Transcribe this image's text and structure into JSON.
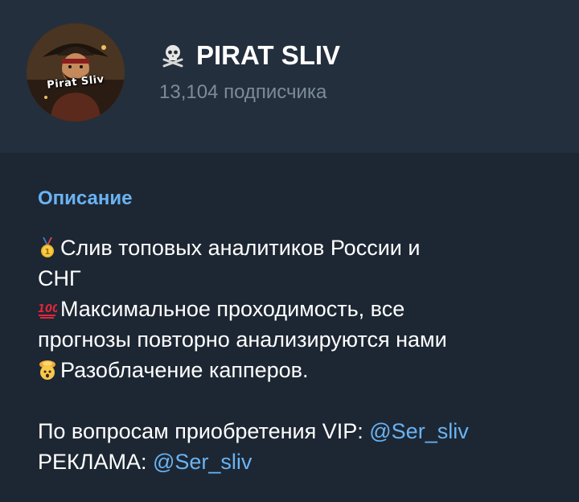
{
  "header": {
    "avatar_label": "Pirat Sliv",
    "title": "PIRAT SLIV",
    "subscribers": "13,104 подписчика",
    "title_icon": "skull-crossbones-icon"
  },
  "description": {
    "section_title": "Описание",
    "line1": "Слив топовых аналитиков России и",
    "line1b": "СНГ",
    "line2": "Максимальное проходимость, все",
    "line2b": "прогнозы повторно анализируются нами",
    "line3": "Разоблачение капперов.",
    "vip_label": "По вопросам приобретения VIP: ",
    "vip_link": "@Ser_sliv",
    "ads_label": "РЕКЛАМА: ",
    "ads_link": "@Ser_sliv",
    "emoji1": "first-place-medal-icon",
    "emoji2": "hundred-points-icon",
    "emoji3": "exploding-head-icon"
  },
  "colors": {
    "background": "#1d2733",
    "header_bg": "#242f3d",
    "accent": "#6ab3f3",
    "muted": "#7c8b9b",
    "text": "#ffffff"
  }
}
